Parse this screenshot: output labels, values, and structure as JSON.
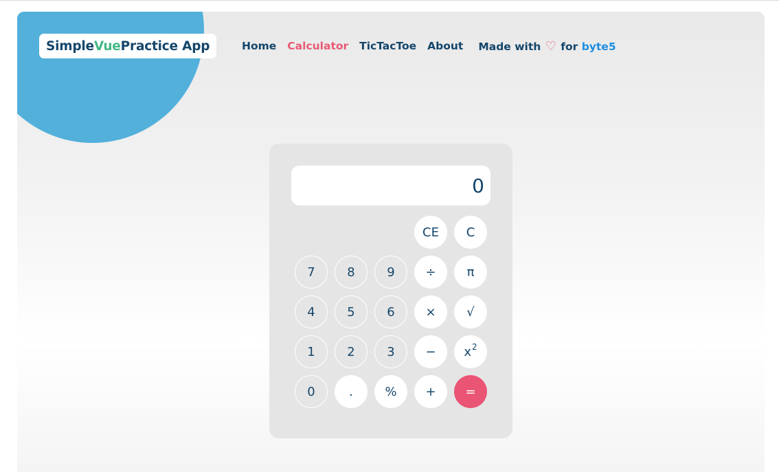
{
  "header": {
    "brand": {
      "part1": "Simple ",
      "part2": "Vue",
      "part3": " Practice App"
    },
    "nav": [
      {
        "label": "Home",
        "active": false
      },
      {
        "label": "Calculator",
        "active": true
      },
      {
        "label": "TicTacToe",
        "active": false
      },
      {
        "label": "About",
        "active": false
      }
    ],
    "credit": {
      "prefix": "Made with",
      "heart": "♡",
      "middle": "for",
      "link": "byte5"
    }
  },
  "calculator": {
    "display": "0",
    "keys": {
      "ce": "CE",
      "c": "C",
      "k7": "7",
      "k8": "8",
      "k9": "9",
      "divide": "÷",
      "pi": "π",
      "k4": "4",
      "k5": "5",
      "k6": "6",
      "multiply": "×",
      "sqrt": "√",
      "k1": "1",
      "k2": "2",
      "k3": "3",
      "minus": "−",
      "square_base": "x",
      "square_exp": "2",
      "k0": "0",
      "dot": ".",
      "percent": "%",
      "plus": "+",
      "equals": "="
    }
  },
  "colors": {
    "accent_blue": "#4badda",
    "text_navy": "#15466b",
    "vue_green": "#42b883",
    "active_pink": "#e85a74",
    "link_blue": "#1f8fe0",
    "equals_pink": "#ea5475"
  }
}
